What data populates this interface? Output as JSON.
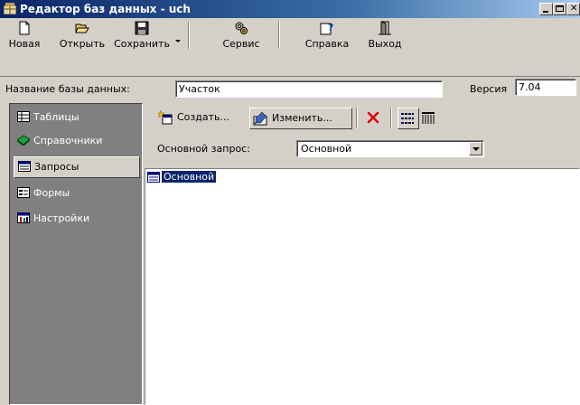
{
  "window": {
    "title": "Редактор баз данных - uch",
    "controls": [
      "minimize",
      "maximize",
      "close"
    ]
  },
  "toolbar": {
    "buttons": [
      {
        "label": "Новая",
        "icon": "new-document-icon"
      },
      {
        "label": "Открыть",
        "icon": "open-folder-icon"
      },
      {
        "label": "Сохранить",
        "icon": "floppy-disk-icon"
      },
      {
        "label": "Сервис",
        "icon": "gears-icon"
      },
      {
        "label": "Справка",
        "icon": "help-icon"
      },
      {
        "label": "Выход",
        "icon": "exit-door-icon"
      }
    ]
  },
  "database": {
    "name_label": "Название базы данных:",
    "name_value": "Участок",
    "version_label": "Версия",
    "version_value": "7.04"
  },
  "sidebar": {
    "items": [
      {
        "label": "Таблицы",
        "icon": "table-icon",
        "active": false
      },
      {
        "label": "Справочники",
        "icon": "book-icon",
        "active": false
      },
      {
        "label": "Запросы",
        "icon": "query-icon",
        "active": true
      },
      {
        "label": "Формы",
        "icon": "form-icon",
        "active": false
      },
      {
        "label": "Настройки",
        "icon": "settings-icon",
        "active": false
      }
    ]
  },
  "queries": {
    "create_label": "Создать...",
    "edit_label": "Изменить...",
    "main_query_label": "Основной запрос:",
    "main_query_value": "Основной",
    "list": [
      {
        "label": "Основной",
        "selected": true
      }
    ]
  },
  "colors": {
    "titlebar_start": "#0a246a",
    "titlebar_end": "#a6caf0",
    "face": "#d4d0c8",
    "sidebar_bg": "#808080",
    "selection": "#0a246a",
    "delete_red": "#e00000"
  }
}
